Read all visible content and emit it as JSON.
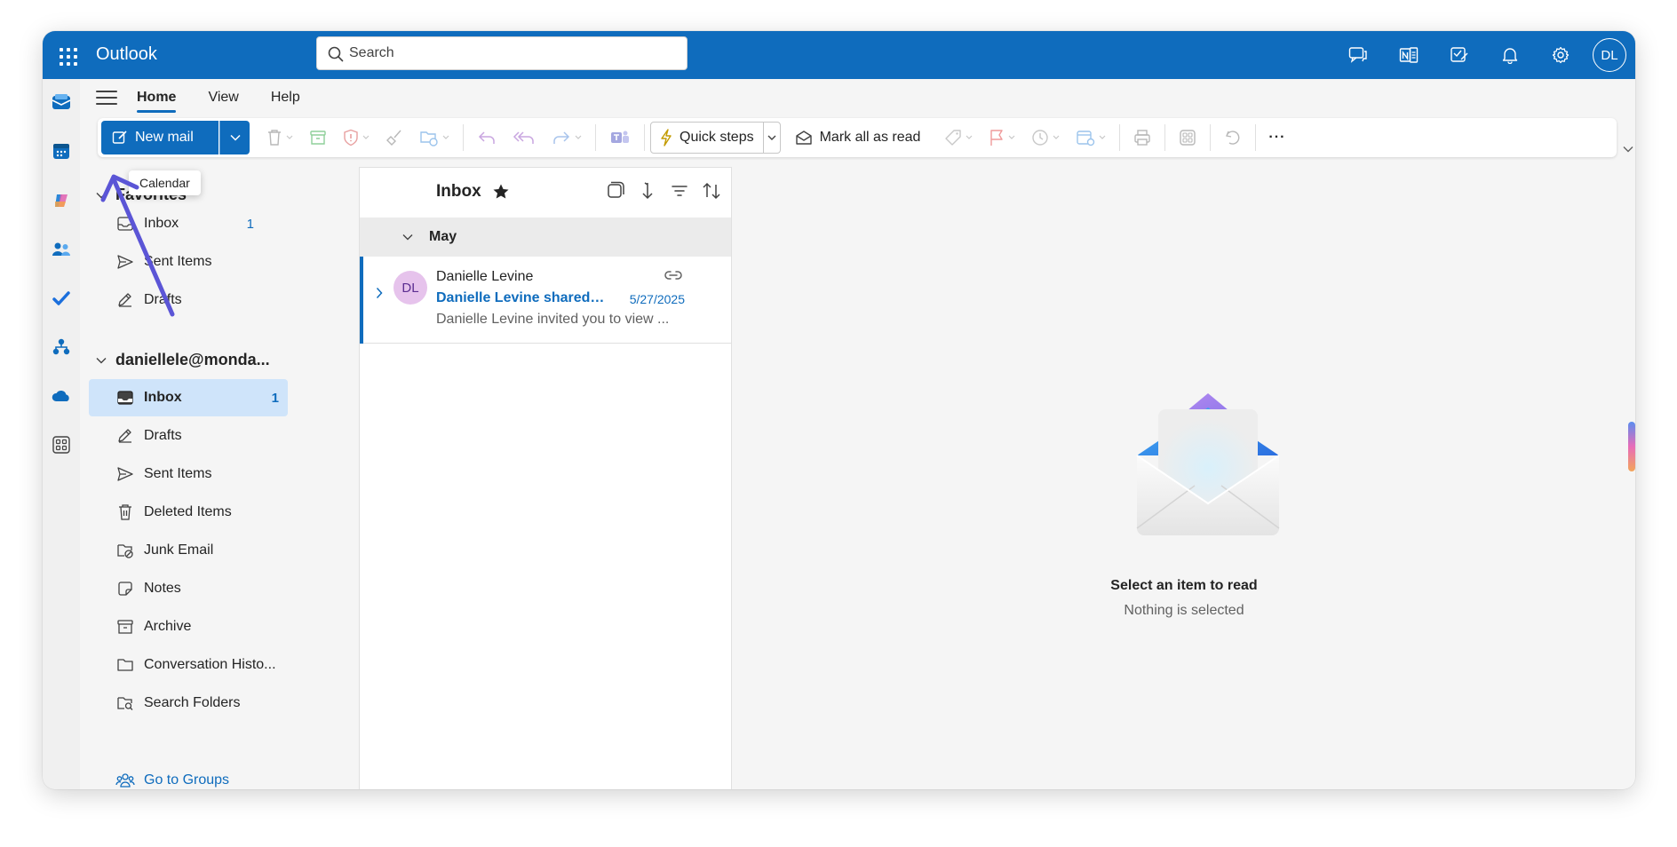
{
  "app": {
    "title": "Outlook",
    "user_initials": "DL"
  },
  "search": {
    "placeholder": "Search"
  },
  "ribbon": {
    "tabs": [
      {
        "label": "Home",
        "active": true
      },
      {
        "label": "View"
      },
      {
        "label": "Help"
      }
    ],
    "new_mail_label": "New mail",
    "quick_steps_label": "Quick steps",
    "mark_all_read_label": "Mark all as read",
    "more_label": "···"
  },
  "tooltip": {
    "text": "Calendar"
  },
  "folders": {
    "favorites_header": "Favorites",
    "favorites": [
      {
        "label": "Inbox",
        "count": "1",
        "icon": "inbox-icon"
      },
      {
        "label": "Sent Items",
        "count": "",
        "icon": "send-icon"
      },
      {
        "label": "Drafts",
        "count": "",
        "icon": "drafts-icon"
      }
    ],
    "account_header": "daniellele@monda...",
    "account_items": [
      {
        "label": "Inbox",
        "count": "1",
        "icon": "inbox-icon",
        "selected": true
      },
      {
        "label": "Drafts",
        "count": "",
        "icon": "drafts-icon"
      },
      {
        "label": "Sent Items",
        "count": "",
        "icon": "send-icon"
      },
      {
        "label": "Deleted Items",
        "count": "",
        "icon": "trash-icon"
      },
      {
        "label": "Junk Email",
        "count": "",
        "icon": "junk-icon"
      },
      {
        "label": "Notes",
        "count": "",
        "icon": "notes-icon"
      },
      {
        "label": "Archive",
        "count": "",
        "icon": "archive-icon"
      },
      {
        "label": "Conversation Histo...",
        "count": "",
        "icon": "folder-icon"
      },
      {
        "label": "Search Folders",
        "count": "",
        "icon": "search-folder-icon"
      }
    ],
    "go_to_groups": "Go to Groups"
  },
  "message_list": {
    "title": "Inbox",
    "group_label": "May",
    "messages": [
      {
        "avatar": "DL",
        "from": "Danielle Levine",
        "subject": "Danielle Levine shared ...",
        "date": "5/27/2025",
        "preview": "Danielle Levine invited you to view ..."
      }
    ]
  },
  "reading_pane": {
    "title": "Select an item to read",
    "subtitle": "Nothing is selected"
  },
  "colors": {
    "brand": "#0f6cbd",
    "selected": "#cfe4fa",
    "annotation_arrow": "#5b55d6"
  }
}
